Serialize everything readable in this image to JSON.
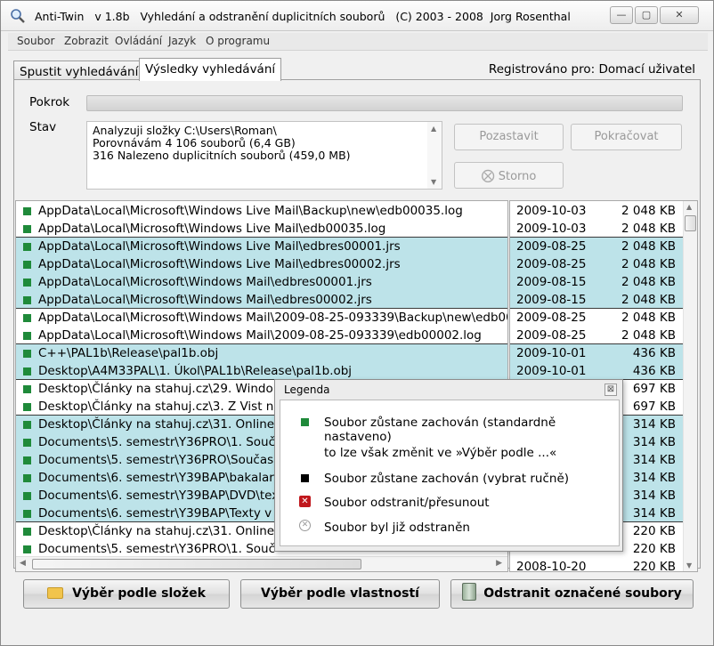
{
  "titlebar": {
    "app": "Anti-Twin",
    "version": "v 1.8b",
    "description": "Vyhledání a odstranění duplicitních souborů",
    "copyright": "(C) 2003 - 2008  Jorg Rosenthal"
  },
  "menu": [
    "Soubor",
    "Zobrazit",
    "Ovládání",
    "Jazyk",
    "O programu"
  ],
  "tabs": {
    "search": "Spustit vyhledávání",
    "results": "Výsledky vyhledávání"
  },
  "registered": "Registrováno pro: Domací uživatel",
  "labels": {
    "progress": "Pokrok",
    "status": "Stav"
  },
  "status_lines": [
    "Analyzuji složky C:\\Users\\Roman\\",
    "Porovnávám 4 106 souborů (6,4 GB)",
    "316 Nalezeno duplicitních souborů (459,0 MB)"
  ],
  "buttons": {
    "pause": "Pozastavit",
    "continue": "Pokračovat",
    "cancel": "Storno"
  },
  "files": [
    {
      "path": "AppData\\Local\\Microsoft\\Windows Live Mail\\Backup\\new\\edb00035.log",
      "date": "2009-10-03",
      "size": "2 048 KB"
    },
    {
      "path": "AppData\\Local\\Microsoft\\Windows Live Mail\\edb00035.log",
      "date": "2009-10-03",
      "size": "2 048 KB"
    },
    {
      "path": "AppData\\Local\\Microsoft\\Windows Live Mail\\edbres00001.jrs",
      "date": "2009-08-25",
      "size": "2 048 KB"
    },
    {
      "path": "AppData\\Local\\Microsoft\\Windows Live Mail\\edbres00002.jrs",
      "date": "2009-08-25",
      "size": "2 048 KB"
    },
    {
      "path": "AppData\\Local\\Microsoft\\Windows Mail\\edbres00001.jrs",
      "date": "2009-08-15",
      "size": "2 048 KB"
    },
    {
      "path": "AppData\\Local\\Microsoft\\Windows Mail\\edbres00002.jrs",
      "date": "2009-08-15",
      "size": "2 048 KB"
    },
    {
      "path": "AppData\\Local\\Microsoft\\Windows Mail\\2009-08-25-093339\\Backup\\new\\edb00",
      "date": "2009-08-25",
      "size": "2 048 KB"
    },
    {
      "path": "AppData\\Local\\Microsoft\\Windows Mail\\2009-08-25-093339\\edb00002.log",
      "date": "2009-08-25",
      "size": "2 048 KB"
    },
    {
      "path": "C++\\PAL1b\\Release\\pal1b.obj",
      "date": "2009-10-01",
      "size": "436 KB"
    },
    {
      "path": "Desktop\\A4M33PAL\\1. Úkol\\PAL1b\\Release\\pal1b.obj",
      "date": "2009-10-01",
      "size": "436 KB"
    },
    {
      "path": "Desktop\\Články na stahuj.cz\\29. Windo",
      "date": "",
      "size": "697 KB"
    },
    {
      "path": "Desktop\\Články na stahuj.cz\\3. Z Vist n",
      "date": "",
      "size": "697 KB"
    },
    {
      "path": "Desktop\\Články na stahuj.cz\\31. Online",
      "date": "",
      "size": "314 KB"
    },
    {
      "path": "Documents\\5. semestr\\Y36PRO\\1. Souč",
      "date": "",
      "size": "314 KB"
    },
    {
      "path": "Documents\\5. semestr\\Y36PRO\\Současn",
      "date": "",
      "size": "314 KB"
    },
    {
      "path": "Documents\\6. semestr\\Y39BAP\\bakalars",
      "date": "",
      "size": "314 KB"
    },
    {
      "path": "Documents\\6. semestr\\Y39BAP\\DVD\\tex",
      "date": "",
      "size": "314 KB"
    },
    {
      "path": "Documents\\6. semestr\\Y39BAP\\Texty v",
      "date": "",
      "size": "314 KB"
    },
    {
      "path": "Desktop\\Články na stahuj.cz\\31. Online",
      "date": "",
      "size": "220 KB"
    },
    {
      "path": "Documents\\5. semestr\\Y36PRO\\1. Souč",
      "date": "",
      "size": "220 KB"
    },
    {
      "path": "",
      "date": "2008-10-20",
      "size": "220 KB"
    }
  ],
  "legend": {
    "title": "Legenda",
    "close": "⊠",
    "items": [
      "Soubor zůstane zachován (standardně nastaveno)",
      "to lze však změnit ve »Výběr podle ...«",
      "Soubor zůstane zachován (vybrat ručně)",
      "Soubor odstranit/přesunout",
      "Soubor byl již odstraněn"
    ]
  },
  "bottom": {
    "by_folder": "Výběr podle složek",
    "by_props": "Výběr podle vlastností",
    "delete": "Odstranit označené soubory"
  },
  "colors": {
    "highlight": "#bde3e9",
    "keep": "#1f8a3a",
    "delete": "#c0171c"
  }
}
